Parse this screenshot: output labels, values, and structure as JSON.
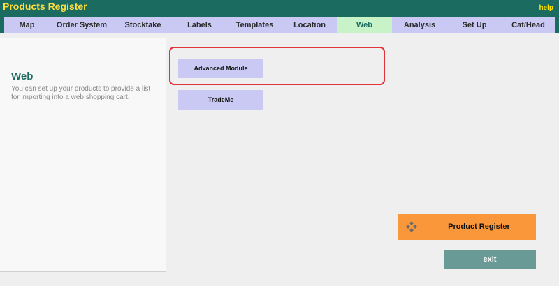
{
  "app": {
    "title": "Products Register",
    "help_label": "help"
  },
  "nav": {
    "tabs": [
      {
        "label": "Map"
      },
      {
        "label": "Order System"
      },
      {
        "label": "Stocktake"
      },
      {
        "label": "Labels"
      },
      {
        "label": "Templates"
      },
      {
        "label": "Location"
      },
      {
        "label": "Web",
        "active": true
      },
      {
        "label": "Analysis"
      },
      {
        "label": "Set Up"
      },
      {
        "label": "Cat/Head"
      }
    ]
  },
  "section": {
    "title": "Web",
    "description": "You can set up your products to provide a list for importing into a web shopping cart."
  },
  "modules": {
    "advanced_label": "Advanced Module",
    "trademe_label": "TradeMe"
  },
  "footer": {
    "product_register_label": "Product Register",
    "product_register_icon": "diamond-cluster-icon",
    "exit_label": "exit"
  },
  "colors": {
    "header_bg": "#1b6b61",
    "title_text": "#ffde3a",
    "tab_bg": "#c9c9f3",
    "active_tab_bg": "#c8f2c8",
    "product_register_bg": "#f9973a",
    "exit_bg": "#6a9a96",
    "highlight": "#e2323a"
  }
}
